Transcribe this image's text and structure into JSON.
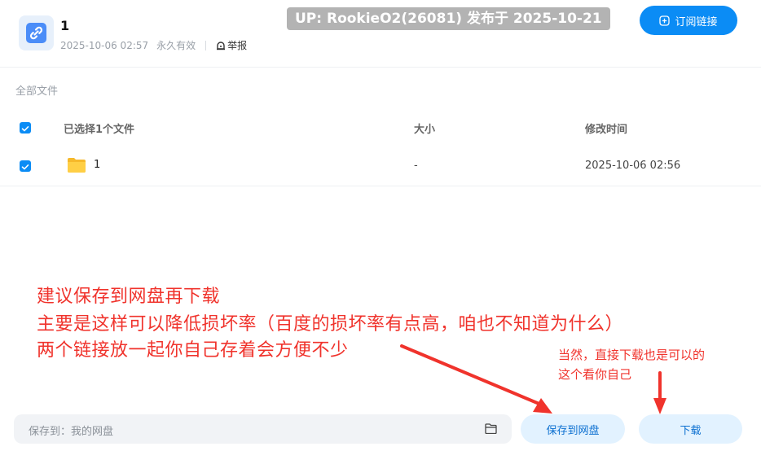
{
  "header": {
    "title": "1",
    "date": "2025-10-06 02:57",
    "validity": "永久有效",
    "report_label": "举报",
    "up_badge": "UP: RookieO2(26081) 发布于 2025-10-21",
    "subscribe_label": "订阅链接"
  },
  "breadcrumb": "全部文件",
  "table": {
    "header": {
      "name": "已选择1个文件",
      "size": "大小",
      "modified": "修改时间"
    },
    "rows": [
      {
        "name": "1",
        "size": "-",
        "modified": "2025-10-06 02:56",
        "checked": true
      }
    ]
  },
  "annotations": {
    "big": [
      "建议保存到网盘再下载",
      "主要是这样可以降低损坏率（百度的损坏率有点高，咱也不知道为什么）",
      "两个链接放一起你自己存着会方便不少"
    ],
    "small": [
      "当然，直接下载也是可以的",
      "这个看你自己"
    ]
  },
  "footer": {
    "save_to_label": "保存到：我的网盘",
    "save_button": "保存到网盘",
    "download_button": "下载"
  },
  "colors": {
    "accent": "#0b8cf5",
    "annotation": "#f0332c",
    "badge": "#b3b3b3"
  },
  "icons": [
    "link-icon",
    "report-icon",
    "plus-icon",
    "checkbox-icon",
    "folder-icon"
  ]
}
